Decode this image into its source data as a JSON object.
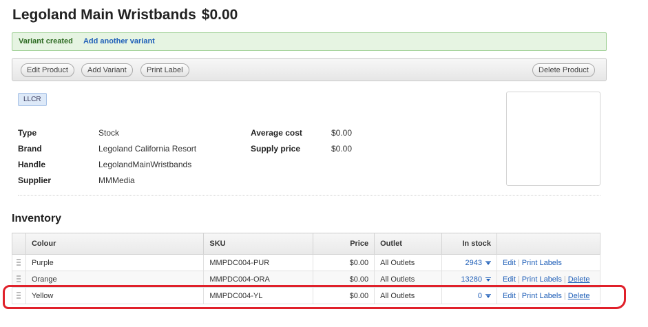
{
  "product": {
    "name": "Legoland Main Wristbands",
    "price": "$0.00"
  },
  "notice": {
    "message": "Variant created",
    "link": "Add another variant"
  },
  "toolbar": {
    "edit": "Edit Product",
    "add_variant": "Add Variant",
    "print": "Print Label",
    "delete": "Delete Product"
  },
  "tag": "LLCR",
  "details_left": [
    {
      "label": "Type",
      "value": "Stock"
    },
    {
      "label": "Brand",
      "value": "Legoland California Resort"
    },
    {
      "label": "Handle",
      "value": "LegolandMainWristbands"
    },
    {
      "label": "Supplier",
      "value": "MMMedia"
    }
  ],
  "details_right": [
    {
      "label": "Average cost",
      "value": "$0.00"
    },
    {
      "label": "Supply price",
      "value": "$0.00"
    }
  ],
  "inventory": {
    "title": "Inventory",
    "columns": {
      "colour": "Colour",
      "sku": "SKU",
      "price": "Price",
      "outlet": "Outlet",
      "in_stock": "In stock"
    },
    "rows": [
      {
        "colour": "Purple",
        "sku": "MMPDC004-PUR",
        "price": "$0.00",
        "outlet": "All Outlets",
        "stock": "2943",
        "edit": "Edit",
        "print": "Print Labels",
        "delete": ""
      },
      {
        "colour": "Orange",
        "sku": "MMPDC004-ORA",
        "price": "$0.00",
        "outlet": "All Outlets",
        "stock": "13280",
        "edit": "Edit",
        "print": "Print Labels",
        "delete": "Delete"
      },
      {
        "colour": "Yellow",
        "sku": "MMPDC004-YL",
        "price": "$0.00",
        "outlet": "All Outlets",
        "stock": "0",
        "edit": "Edit",
        "print": "Print Labels",
        "delete": "Delete"
      }
    ]
  },
  "colors": {
    "highlight": "#e0202a",
    "link": "#1f5fb8",
    "notice_bg": "#e6f4e2"
  }
}
